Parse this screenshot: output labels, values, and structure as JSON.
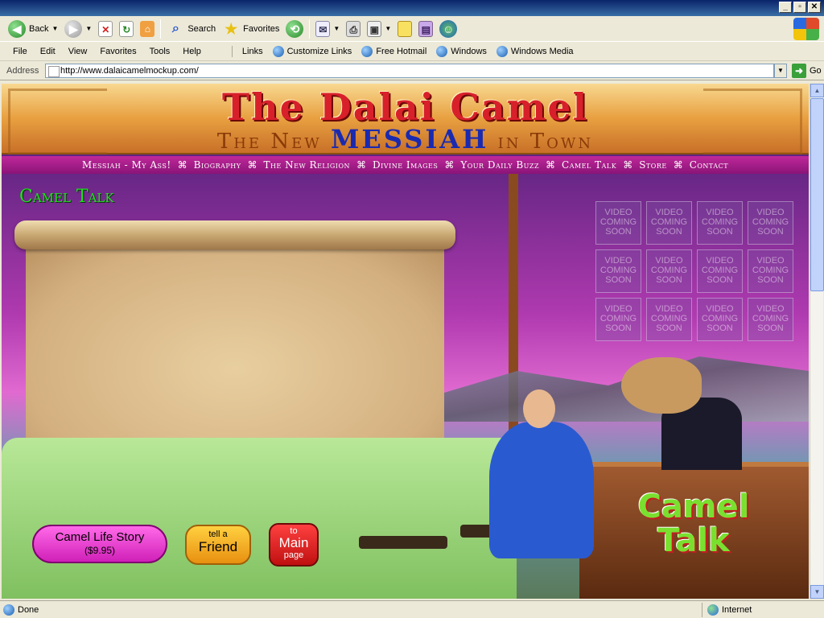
{
  "window": {
    "controls": [
      "_",
      "▫",
      "✕"
    ]
  },
  "toolbar": {
    "back_label": "Back",
    "search_label": "Search",
    "favorites_label": "Favorites"
  },
  "menu": {
    "items": [
      "File",
      "Edit",
      "View",
      "Favorites",
      "Tools",
      "Help"
    ],
    "links_label": "Links",
    "links": [
      "Customize Links",
      "Free Hotmail",
      "Windows",
      "Windows Media"
    ]
  },
  "address": {
    "label": "Address",
    "url": "http://www.dalaicamelmockup.com/",
    "go_label": "Go"
  },
  "site": {
    "title": "The Dalai Camel",
    "tagline_pre": "The New ",
    "tagline_mid": "MESSIAH",
    "tagline_post": " in Town",
    "nav": [
      "Messiah - My Ass!",
      "Biography",
      "The New Religion",
      "Divine Images",
      "Your Daily Buzz",
      "Camel Talk",
      "Store",
      "Contact"
    ],
    "nav_separator": "⌘",
    "section_title": "Camel Talk",
    "video_placeholder": "VIDEO COMING SOON",
    "video_count": 12,
    "logo_line1": "Camel",
    "logo_line2": "Talk",
    "btn_life_title": "Camel Life Story",
    "btn_life_price": "($9.95)",
    "btn_friend_small": "tell a",
    "btn_friend_big": "Friend",
    "btn_main_small": "to",
    "btn_main_big": "Main",
    "btn_main_small2": "page"
  },
  "status": {
    "text": "Done",
    "zone": "Internet"
  },
  "colors": {
    "title_red": "#d8202a",
    "nav_magenta": "#a01e88",
    "section_green": "#22dd22"
  }
}
